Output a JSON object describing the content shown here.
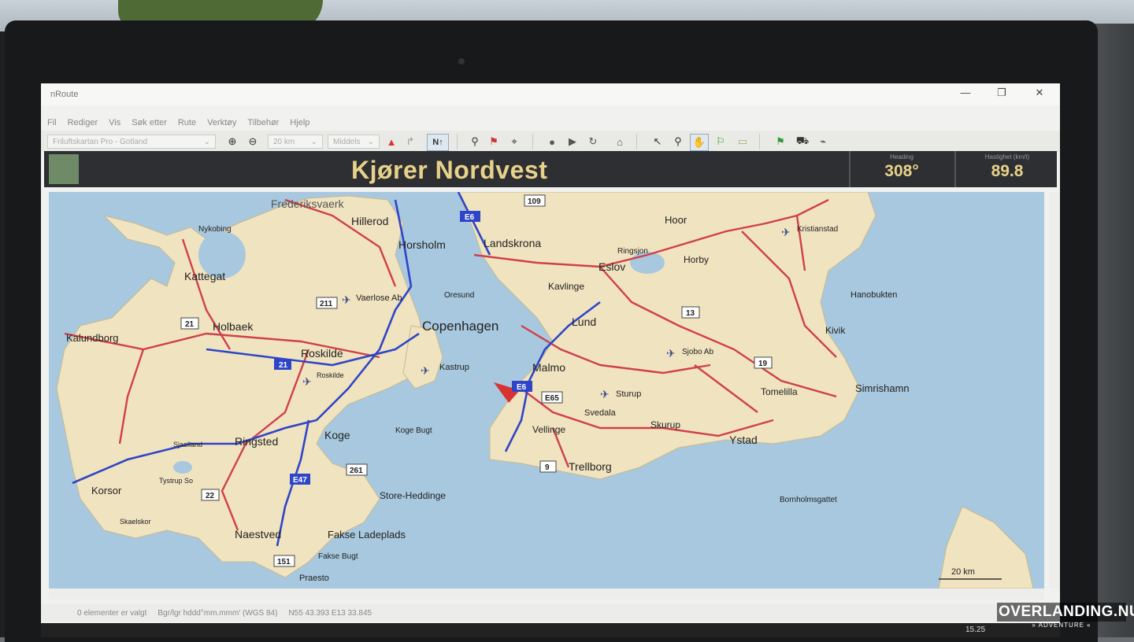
{
  "window": {
    "app_title": "nRoute",
    "minimize_glyph": "—",
    "maximize_glyph": "❐",
    "close_glyph": "✕"
  },
  "menu": [
    "Fil",
    "Rediger",
    "Vis",
    "Søk etter",
    "Rute",
    "Verktøy",
    "Tilbehør",
    "Hjelp"
  ],
  "toolbar": {
    "map_select": "Friluftskartan Pro - Gotland",
    "zoom_select": "20 km",
    "speed_select": "Middels",
    "north_up_label": "N↑"
  },
  "status_band": {
    "title": "Kjører Nordvest",
    "heading_label": "Heading",
    "heading_value": "308°",
    "speed_label": "Hastighet (km/t)",
    "speed_value": "89.8"
  },
  "map": {
    "labels": {
      "frederiksvaerk": "Frederiksvaerk",
      "nykobing": "Nykobing",
      "hillerod": "Hillerod",
      "horsholm": "Horsholm",
      "landskrona": "Landskrona",
      "hoor": "Hoor",
      "kristianstad": "Kristianstad",
      "kattegat": "Kattegat",
      "vaerlose": "Vaerlose Ab",
      "oresund": "Oresund",
      "ringsjon": "Ringsjon",
      "horby": "Horby",
      "eslov": "Eslov",
      "kavlinge": "Kavlinge",
      "hanobukten": "Hanobukten",
      "holbaek": "Holbaek",
      "kalundborg": "Kalundborg",
      "copenhagen": "Copenhagen",
      "lund": "Lund",
      "kivik": "Kivik",
      "roskilde": "Roskilde",
      "roskilde_small": "Roskilde",
      "kastrup": "Kastrup",
      "malmo": "Malmo",
      "sjobo": "Sjobo Ab",
      "simrishamn": "Simrishamn",
      "tomelilla": "Tomelilla",
      "sturup": "Sturup",
      "svedala": "Svedala",
      "koge_bugt": "Koge Bugt",
      "vellinge": "Vellinge",
      "skurup": "Skurup",
      "ystad": "Ystad",
      "ringsted": "Ringsted",
      "sjaelland": "Sjaelland",
      "koge": "Koge",
      "tystrup": "Tystrup So",
      "korsor": "Korsor",
      "skaelskor": "Skaelskor",
      "trellborg": "Trellborg",
      "store_heddinge": "Store-Heddinge",
      "bornholmsgattet": "Bornholmsgattet",
      "naestved": "Naestved",
      "fakse_ladeplads": "Fakse Ladeplads",
      "fakse_bugt": "Fakse Bugt",
      "praesto": "Praesto",
      "scale": "20 km"
    },
    "road_shields": {
      "e6_top": "E6",
      "e6_mid": "E6",
      "e65": "E65",
      "e47": "E47",
      "r21_blue": "21",
      "r21_white": "21",
      "r211": "211",
      "r109": "109",
      "r13": "13",
      "r19": "19",
      "r9": "9",
      "r261": "261",
      "r22": "22",
      "r151": "151"
    }
  },
  "statusbar": {
    "selection": "0 elementer er valgt",
    "format": "Bgr/lgr hddd°mm.mmm' (WGS 84)",
    "position": "N55 43.393 E13 33.845"
  },
  "taskbar": {
    "clock": "15.25"
  },
  "watermark": {
    "name": "OVERLANDING.NU",
    "tagline": "» ADVENTURE «"
  }
}
